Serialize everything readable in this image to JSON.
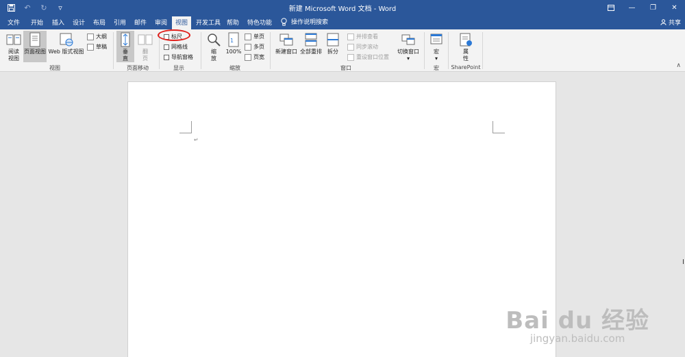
{
  "window": {
    "title": "新建 Microsoft Word 文档 - Word"
  },
  "qat": {
    "save_icon": "save-icon",
    "undo_icon": "undo-icon",
    "redo_icon": "redo-icon",
    "customize_icon": "customize-icon"
  },
  "tabs": [
    {
      "label": "文件"
    },
    {
      "label": "开始"
    },
    {
      "label": "插入"
    },
    {
      "label": "设计"
    },
    {
      "label": "布局"
    },
    {
      "label": "引用"
    },
    {
      "label": "邮件"
    },
    {
      "label": "审阅"
    },
    {
      "label": "视图"
    },
    {
      "label": "开发工具"
    },
    {
      "label": "帮助"
    },
    {
      "label": "特色功能"
    }
  ],
  "tell_me": "操作说明搜索",
  "share": "共享",
  "ribbon": {
    "views": {
      "read": "阅读\n视图",
      "print": "页面视图",
      "web": "Web 版式视图",
      "outline": "大纲",
      "draft": "草稿",
      "group": "视图"
    },
    "page_move": {
      "vertical": "垂\n直",
      "side": "翻\n页",
      "group": "页面移动"
    },
    "show": {
      "ruler": "标尺",
      "gridlines": "网格线",
      "nav": "导航窗格",
      "group": "显示"
    },
    "zoom": {
      "zoom": "缩\n放",
      "pct": "100%",
      "single": "单页",
      "multi": "多页",
      "width": "页宽",
      "group": "缩放"
    },
    "window": {
      "new": "新建窗口",
      "arrange": "全部重排",
      "split": "拆分",
      "side_by_side": "并排查看",
      "sync": "同步滚动",
      "reset": "重设窗口位置",
      "switch": "切换窗口",
      "group": "窗口"
    },
    "macro": {
      "macro": "宏",
      "group": "宏"
    },
    "sharepoint": {
      "props": "属\n性",
      "group": "SharePoint"
    }
  },
  "watermark": {
    "line1": "Bai du 经验",
    "line2": "jingyan.baidu.com"
  }
}
